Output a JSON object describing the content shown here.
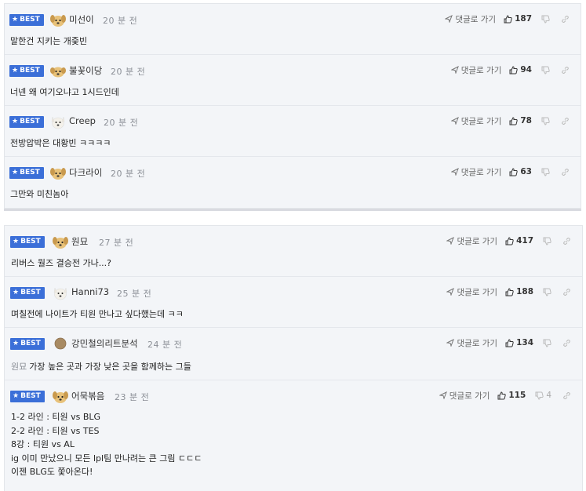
{
  "best_label": "BEST",
  "reply_label": "댓글로 가기",
  "accent_color": "#3b6fd8",
  "panel1": [
    {
      "nick": "미선이",
      "time": "20 분 전",
      "likes": "187",
      "avatar": "puppy-icon",
      "text": "말한건 지키는 개줒빈"
    },
    {
      "nick": "불꽃이당",
      "time": "20 분 전",
      "likes": "94",
      "avatar": "puppy-icon",
      "text": "너넨 왜 여기오냐고 1시드인데"
    },
    {
      "nick": "Creep",
      "time": "20 분 전",
      "likes": "78",
      "avatar": "white-dog-icon",
      "text": "전방압박은 대황빈 ㅋㅋㅋㅋ"
    },
    {
      "nick": "다크라이",
      "time": "20 분 전",
      "likes": "63",
      "avatar": "puppy-icon",
      "text": "그만와 미친놈아"
    }
  ],
  "panel2": [
    {
      "nick": "원묘",
      "time": "27 분 전",
      "likes": "417",
      "avatar": "puppy-icon",
      "text": "리버스 월즈 결승전 가나...?"
    },
    {
      "nick": "Hanni73",
      "time": "25 분 전",
      "likes": "188",
      "avatar": "white-dog-icon",
      "text": "며칠전에 나이트가 티원 만나고 싶다했는데 ㅋㅋ"
    },
    {
      "nick": "강민철의리트분석",
      "time": "24 분 전",
      "likes": "134",
      "avatar": "round-avatar-icon",
      "mention": "원묘",
      "text": "가장 높은 곳과 가장 낮은 곳을 함께하는 그들"
    },
    {
      "nick": "어묵볶음",
      "time": "23 분 전",
      "likes": "115",
      "dislikes": "4",
      "avatar": "puppy-icon",
      "lines": [
        "1-2 라인 : 티원 vs BLG",
        "2-2 라인 : 티원 vs TES",
        "8강 : 티원 vs AL",
        "ig 이미 만났으니 모든 lpl팀 만나려는 큰 그림 ㄷㄷㄷ",
        "이젠 BLG도 쫓아온다!"
      ]
    }
  ]
}
